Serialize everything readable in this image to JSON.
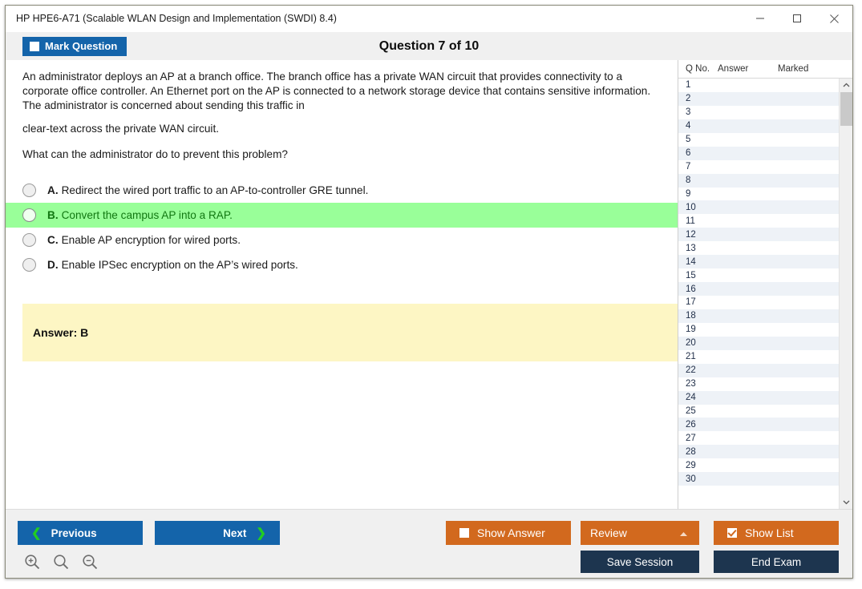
{
  "window": {
    "title": "HP HPE6-A71 (Scalable WLAN Design and Implementation (SWDI) 8.4)",
    "minimize_icon": "minimize-icon",
    "maximize_icon": "maximize-icon",
    "close_icon": "close-icon"
  },
  "header": {
    "mark_question_label": "Mark Question",
    "mark_question_checked": false,
    "question_counter": "Question 7 of 10"
  },
  "question": {
    "paragraph_1": "An administrator deploys an AP at a branch office. The branch office has a private WAN circuit that provides connectivity to a corporate office controller. An Ethernet port on the AP is connected to a network storage device that contains sensitive information. The administrator is concerned about sending this traffic in",
    "paragraph_2": "clear-text across the private WAN circuit.",
    "paragraph_3": "What can the administrator do to prevent this problem?",
    "options": [
      {
        "letter": "A.",
        "text": "Redirect the wired port traffic to an AP-to-controller GRE tunnel.",
        "highlighted": false,
        "selected": false
      },
      {
        "letter": "B.",
        "text": "Convert the campus AP into a RAP.",
        "highlighted": true,
        "selected": false
      },
      {
        "letter": "C.",
        "text": "Enable AP encryption for wired ports.",
        "highlighted": false,
        "selected": false
      },
      {
        "letter": "D.",
        "text": "Enable IPSec encryption on the AP’s wired ports.",
        "highlighted": false,
        "selected": false
      }
    ],
    "answer_label": "Answer: B"
  },
  "question_list": {
    "columns": [
      "Q No.",
      "Answer",
      "Marked"
    ],
    "rows": [
      {
        "no": "1",
        "answer": "",
        "marked": ""
      },
      {
        "no": "2",
        "answer": "",
        "marked": ""
      },
      {
        "no": "3",
        "answer": "",
        "marked": ""
      },
      {
        "no": "4",
        "answer": "",
        "marked": ""
      },
      {
        "no": "5",
        "answer": "",
        "marked": ""
      },
      {
        "no": "6",
        "answer": "",
        "marked": ""
      },
      {
        "no": "7",
        "answer": "",
        "marked": ""
      },
      {
        "no": "8",
        "answer": "",
        "marked": ""
      },
      {
        "no": "9",
        "answer": "",
        "marked": ""
      },
      {
        "no": "10",
        "answer": "",
        "marked": ""
      },
      {
        "no": "11",
        "answer": "",
        "marked": ""
      },
      {
        "no": "12",
        "answer": "",
        "marked": ""
      },
      {
        "no": "13",
        "answer": "",
        "marked": ""
      },
      {
        "no": "14",
        "answer": "",
        "marked": ""
      },
      {
        "no": "15",
        "answer": "",
        "marked": ""
      },
      {
        "no": "16",
        "answer": "",
        "marked": ""
      },
      {
        "no": "17",
        "answer": "",
        "marked": ""
      },
      {
        "no": "18",
        "answer": "",
        "marked": ""
      },
      {
        "no": "19",
        "answer": "",
        "marked": ""
      },
      {
        "no": "20",
        "answer": "",
        "marked": ""
      },
      {
        "no": "21",
        "answer": "",
        "marked": ""
      },
      {
        "no": "22",
        "answer": "",
        "marked": ""
      },
      {
        "no": "23",
        "answer": "",
        "marked": ""
      },
      {
        "no": "24",
        "answer": "",
        "marked": ""
      },
      {
        "no": "25",
        "answer": "",
        "marked": ""
      },
      {
        "no": "26",
        "answer": "",
        "marked": ""
      },
      {
        "no": "27",
        "answer": "",
        "marked": ""
      },
      {
        "no": "28",
        "answer": "",
        "marked": ""
      },
      {
        "no": "29",
        "answer": "",
        "marked": ""
      },
      {
        "no": "30",
        "answer": "",
        "marked": ""
      }
    ]
  },
  "footer": {
    "previous_label": "Previous",
    "next_label": "Next",
    "show_answer_label": "Show Answer",
    "show_answer_checked": false,
    "review_label": "Review",
    "show_list_label": "Show List",
    "show_list_checked": true,
    "save_session_label": "Save Session",
    "end_exam_label": "End Exam",
    "zoom_in_icon": "zoom-in-icon",
    "zoom_reset_icon": "zoom-reset-icon",
    "zoom_out_icon": "zoom-out-icon"
  },
  "colors": {
    "primary_blue": "#1464aa",
    "accent_orange": "#d2691e",
    "dark_navy": "#1d354f",
    "highlight_green": "#99ff99",
    "answer_yellow": "#fdf6c4",
    "chevron_green": "#22cc22"
  }
}
